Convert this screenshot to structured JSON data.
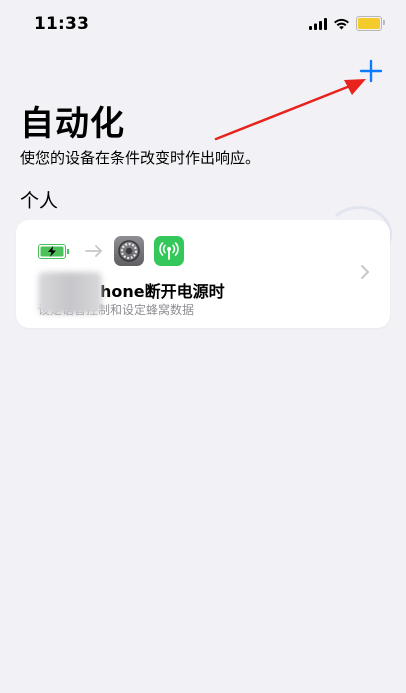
{
  "status_bar": {
    "time": "11:33",
    "icons": [
      "cellular-signal-icon",
      "wifi-icon",
      "battery-icon"
    ],
    "battery_color": "#f4cb2c"
  },
  "header": {
    "add_icon": "plus-icon",
    "accent_color": "#0a7cff",
    "title": "自动化",
    "subtitle": "使您的设备在条件改变时作出响应。"
  },
  "section": {
    "title": "个人"
  },
  "automations": [
    {
      "trigger_icon": "battery-charging-icon",
      "arrow_icon": "arrow-right-icon",
      "action_icons": [
        "settings-app-icon",
        "cellular-data-app-icon"
      ],
      "title": "hone断开电源时",
      "description": "设定语音控制和设定蜂窝数据",
      "chevron_icon": "chevron-right-icon"
    }
  ],
  "annotation": {
    "color": "#e8221c",
    "type": "arrow-pointing-to-add-button"
  }
}
